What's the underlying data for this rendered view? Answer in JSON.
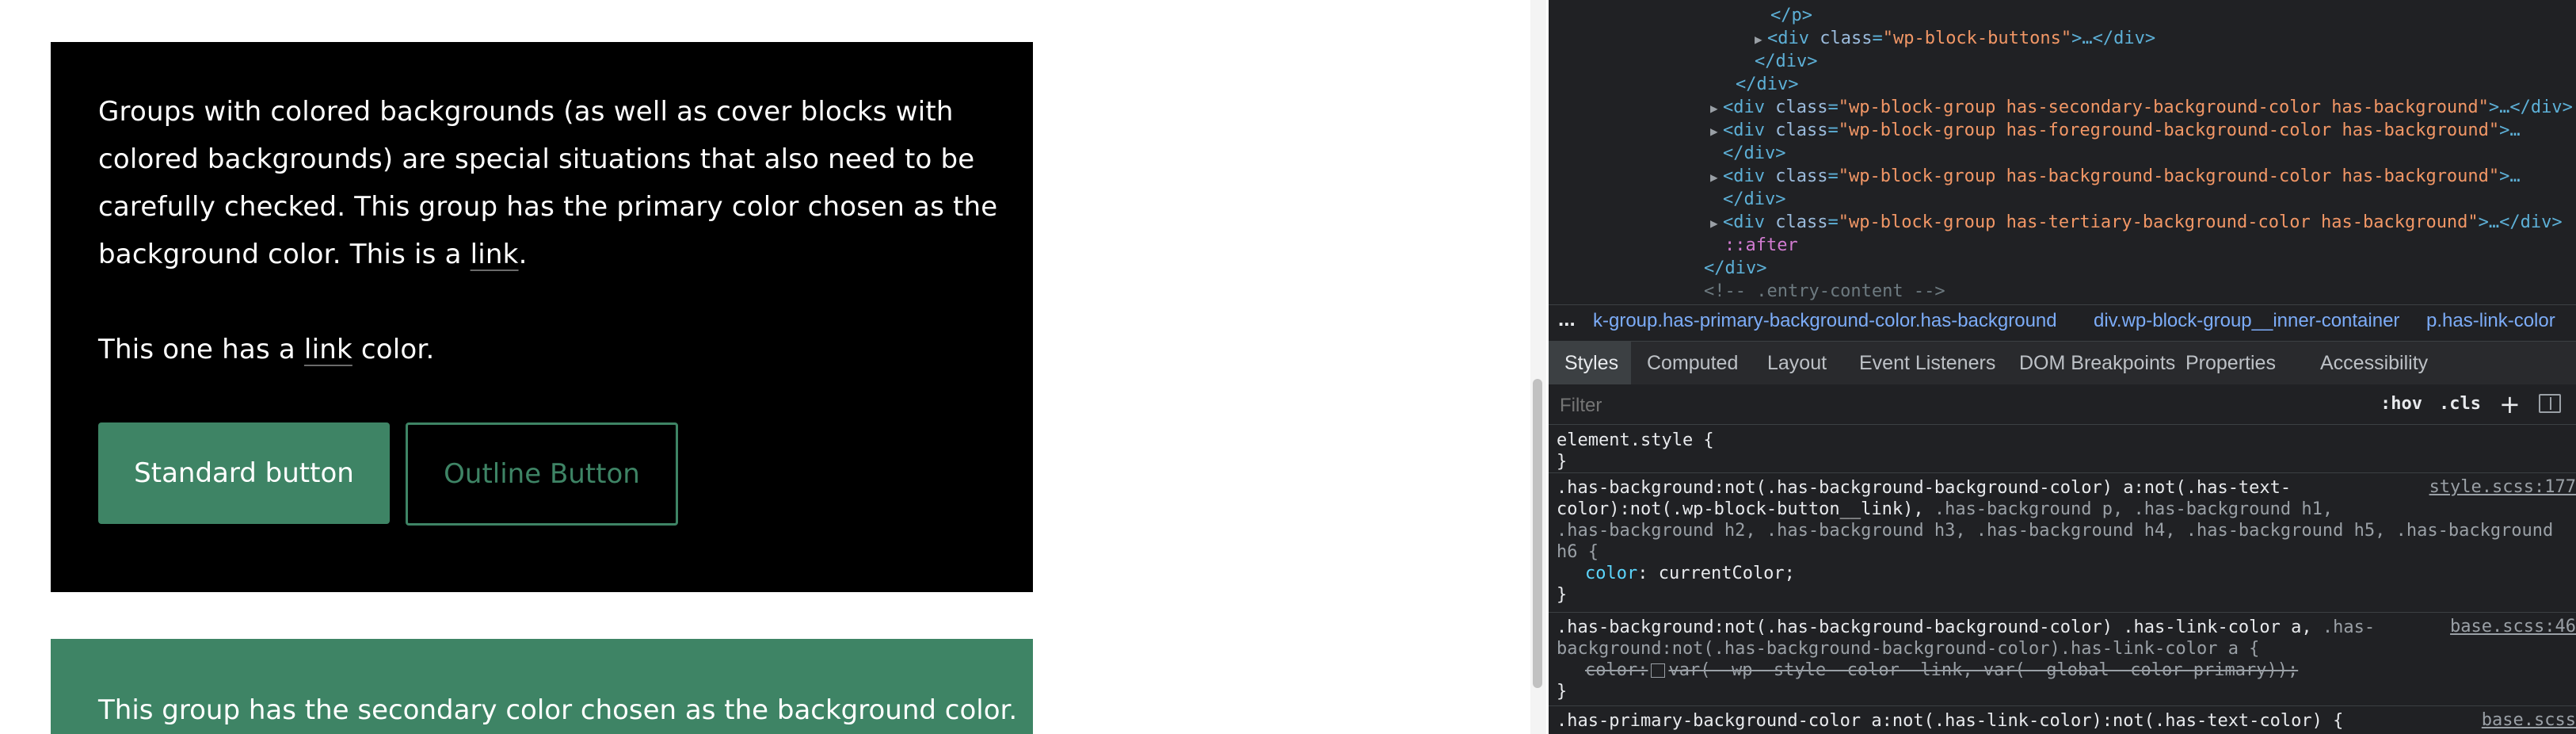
{
  "preview": {
    "black_group": {
      "p1_text_before_link": "Groups with colored backgrounds (as well as cover blocks with colored backgrounds) are special situations that also need to be carefully checked. This group has the primary color chosen as the background color. This is a ",
      "p1_link": "link",
      "p1_after_link": ".",
      "p2_before_link": "This one has a ",
      "p2_link": "link",
      "p2_after_link": " color.",
      "standard_button": "Standard button",
      "outline_button": "Outline Button"
    },
    "green_group": {
      "text": "This group has the secondary color chosen as the background color."
    },
    "colors": {
      "black_bg": "#000000",
      "green": "#3e8465"
    }
  },
  "devtools": {
    "dom_lines": [
      {
        "kind": "close",
        "text": "</p>"
      },
      {
        "kind": "el",
        "open": "<div ",
        "attr": "class",
        "val": "\"wp-block-buttons\"",
        "rest": ">…</div>"
      },
      {
        "kind": "close",
        "text": "</div>"
      },
      {
        "kind": "close",
        "text": "</div>"
      },
      {
        "kind": "el",
        "open": "<div ",
        "attr": "class",
        "val": "\"wp-block-group has-secondary-background-color has-background\"",
        "rest": ">…</div>"
      },
      {
        "kind": "el",
        "open": "<div ",
        "attr": "class",
        "val": "\"wp-block-group has-foreground-background-color has-background\"",
        "rest": ">…"
      },
      {
        "kind": "close",
        "text": "</div>"
      },
      {
        "kind": "el",
        "open": "<div ",
        "attr": "class",
        "val": "\"wp-block-group has-background-background-color has-background\"",
        "rest": ">…"
      },
      {
        "kind": "close",
        "text": "</div>"
      },
      {
        "kind": "el",
        "open": "<div ",
        "attr": "class",
        "val": "\"wp-block-group has-tertiary-background-color has-background\"",
        "rest": ">…</div>"
      },
      {
        "kind": "pseudo",
        "text": "::after"
      },
      {
        "kind": "close",
        "text": "</div>"
      },
      {
        "kind": "comment",
        "text": "<!-- .entry-content -->"
      }
    ],
    "breadcrumbs": {
      "dots": "...",
      "items": [
        "k-group.has-primary-background-color.has-background",
        "div.wp-block-group__inner-container",
        "p.has-link-color"
      ]
    },
    "tabs": [
      "Styles",
      "Computed",
      "Layout",
      "Event Listeners",
      "DOM Breakpoints",
      "Properties",
      "Accessibility"
    ],
    "filter": {
      "placeholder": "Filter",
      "hov": ":hov",
      "cls": ".cls",
      "plus": "+"
    },
    "rules": {
      "element_style": {
        "selector": "element.style {",
        "close": "}"
      },
      "rule1": {
        "sel_line1": ".has-background:not(.has-background-background-color) a:not(.has-text-",
        "sel_line2a": "color):not(.wp-block-button__link), ",
        "sel_line2b": ".has-background p, .has-background h1,",
        "sel_line3": ".has-background h2, .has-background h3, .has-background h4, .has-background h5, .has-background",
        "sel_line4": "h6 {",
        "prop": "color",
        "value": "currentColor;",
        "close": "}",
        "source": "style.scss:177"
      },
      "rule2": {
        "sel_line1a": ".has-background:not(.has-background-background-color) .has-link-color a, ",
        "sel_line1b": ".has-",
        "sel_line2": "background:not(.has-background-background-color).has-link-color a {",
        "prop": "color:",
        "value": "var(--wp--style--color--link, var(--global--color-primary));",
        "close": "}",
        "source": "base.scss:46"
      },
      "rule3": {
        "sel_line1": ".has-primary-background-color a:not(.has-link-color):not(.has-text-color) {",
        "source": "base.scss"
      }
    }
  }
}
